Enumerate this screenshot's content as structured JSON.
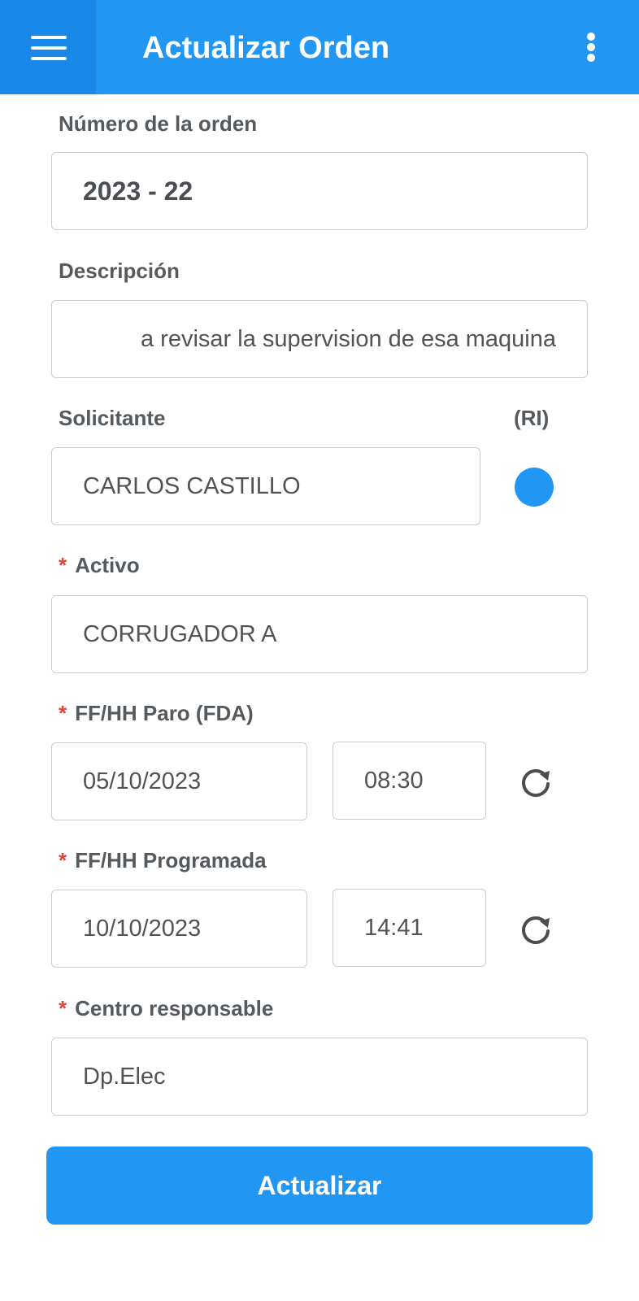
{
  "appbar": {
    "title": "Actualizar Orden",
    "menu_icon": "hamburger-menu-icon",
    "more_icon": "more-vertical-icon",
    "color": "#2196f3"
  },
  "form": {
    "order_number": {
      "label": "Número de la orden",
      "value": "2023 - 22"
    },
    "description": {
      "label": "Descripción",
      "value": "a revisar la supervision de esa maquina"
    },
    "requester": {
      "label": "Solicitante",
      "value": "CARLOS CASTILLO",
      "ri_label": "(RI)",
      "ri_color": "#2196f3"
    },
    "asset": {
      "required_mark": "*",
      "label": "Activo",
      "value": "CORRUGADOR A"
    },
    "stop_datetime": {
      "required_mark": "*",
      "label": "FF/HH Paro (FDA)",
      "date": "05/10/2023",
      "time": "08:30",
      "refresh_icon": "refresh-icon"
    },
    "scheduled_datetime": {
      "required_mark": "*",
      "label": "FF/HH Programada",
      "date": "10/10/2023",
      "time": "14:41",
      "refresh_icon": "refresh-icon"
    },
    "responsible_center": {
      "required_mark": "*",
      "label": "Centro responsable",
      "value": "Dp.Elec"
    }
  },
  "submit": {
    "label": "Actualizar"
  },
  "colors": {
    "accent": "#2196f3",
    "required": "#e0463a",
    "label": "#555a5f",
    "border": "#c8cdd2"
  }
}
